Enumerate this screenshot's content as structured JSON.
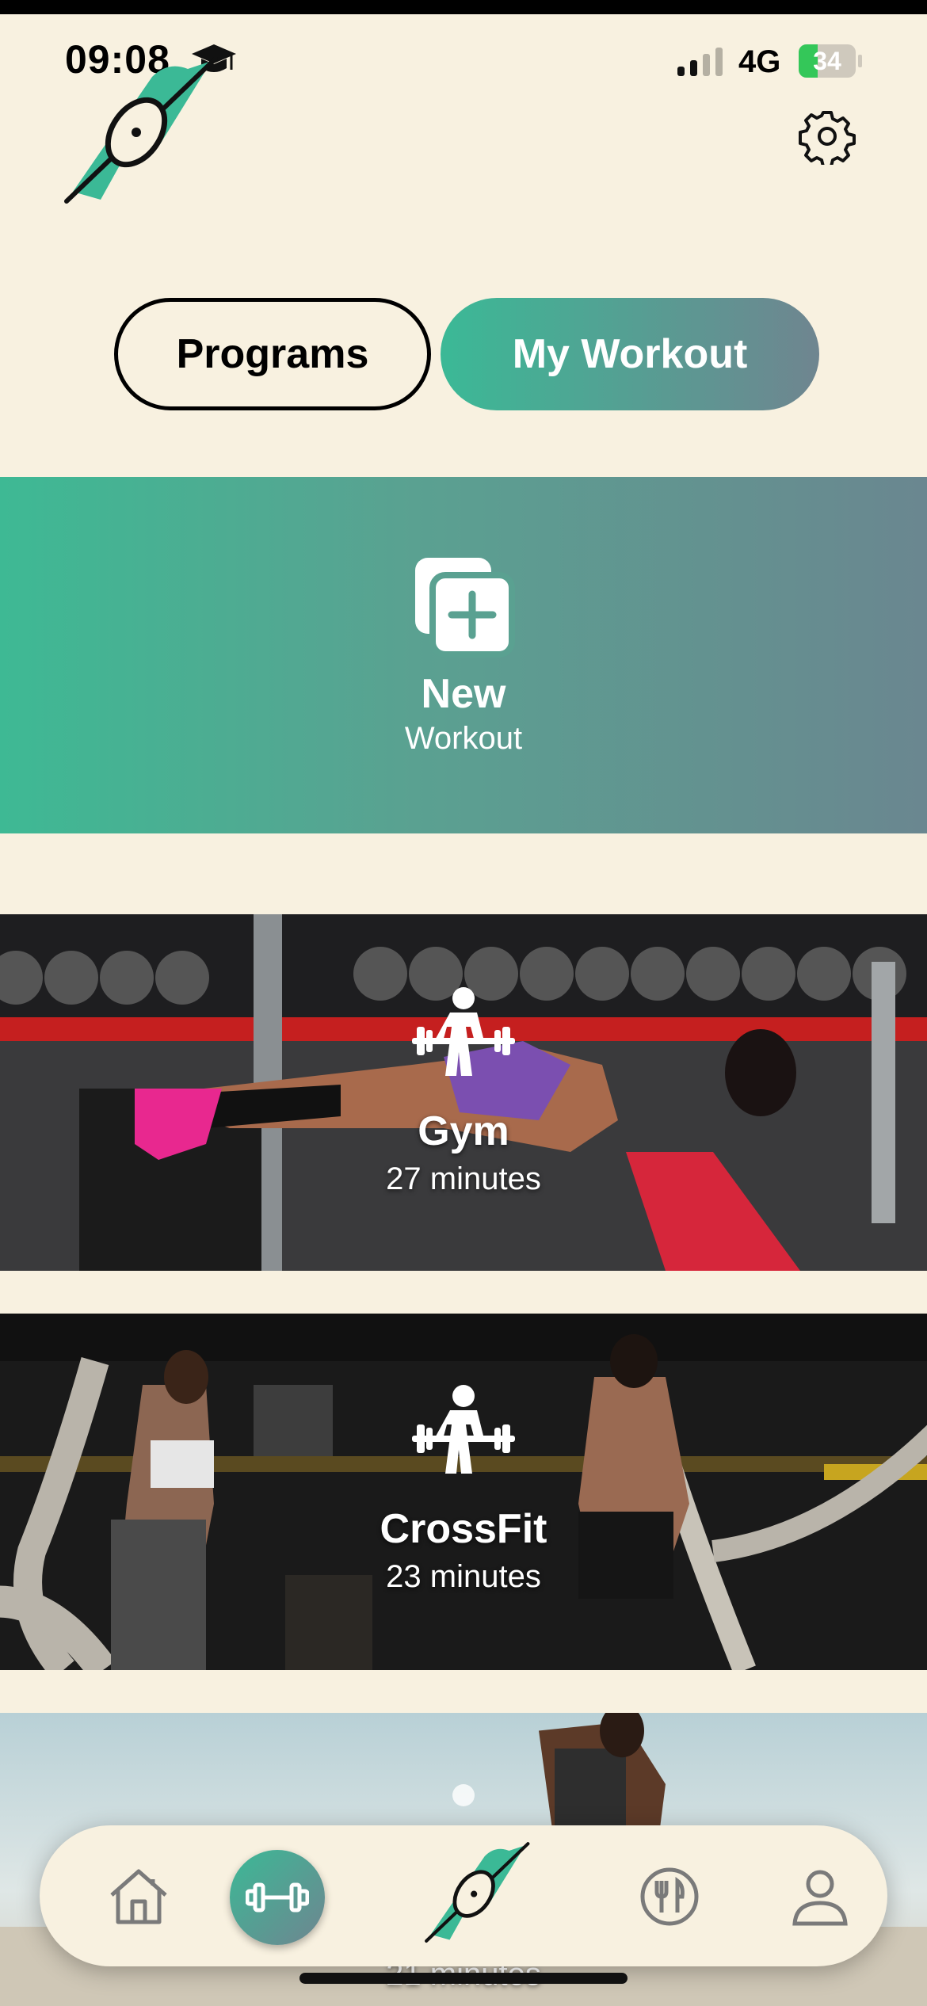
{
  "status_bar": {
    "time": "09:08",
    "network": "4G",
    "battery": "34"
  },
  "tabs": {
    "programs": "Programs",
    "my_workout": "My Workout"
  },
  "new_workout": {
    "title": "New",
    "subtitle": "Workout"
  },
  "workouts": [
    {
      "title": "Gym",
      "duration": "27 minutes"
    },
    {
      "title": "CrossFit",
      "duration": "23 minutes"
    },
    {
      "title": "",
      "duration": "21 minutes"
    }
  ],
  "colors": {
    "background": "#f8f1e0",
    "accent": "#3bb996",
    "accent_end": "#6f8590"
  },
  "icons": {
    "settings": "gear-icon",
    "new": "add-copy-icon",
    "workout": "weightlifter-icon",
    "home": "home-icon",
    "dumbbell": "dumbbell-icon",
    "logo": "app-logo-icon",
    "food": "fork-knife-icon",
    "profile": "person-icon"
  }
}
